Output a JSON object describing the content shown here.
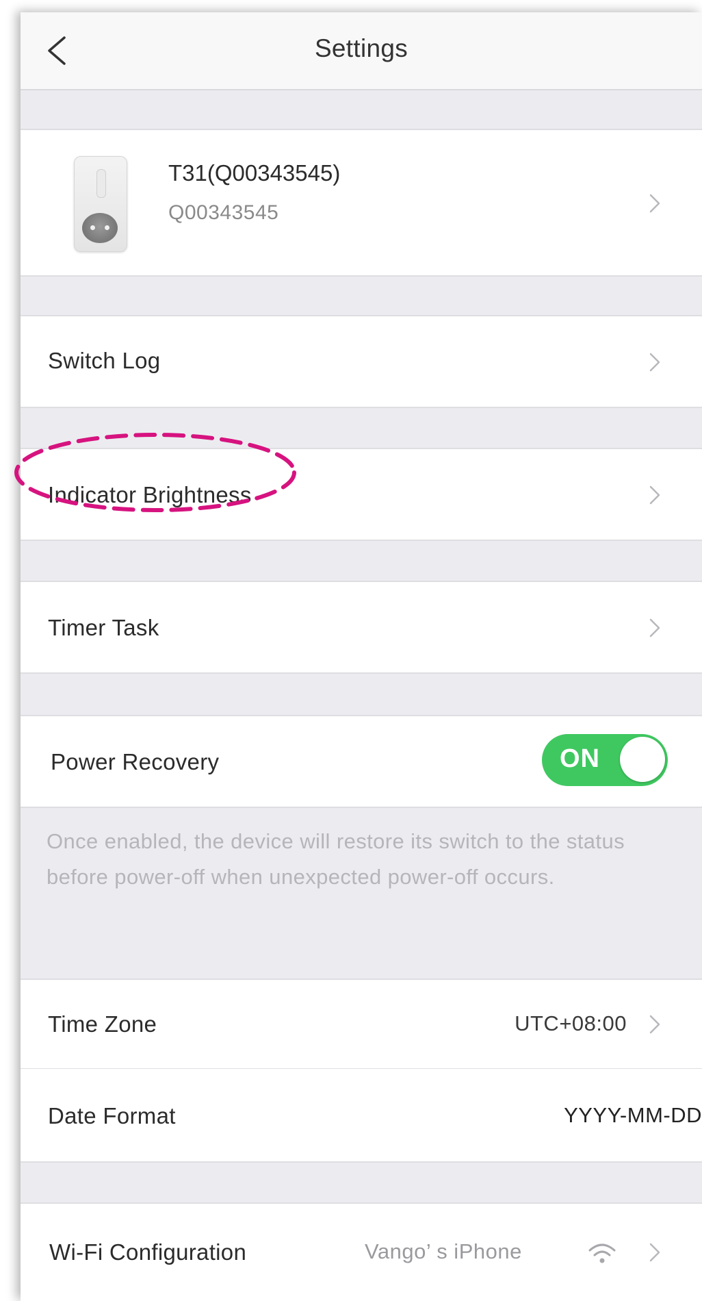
{
  "nav": {
    "title": "Settings"
  },
  "device": {
    "name": "T31(Q00343545)",
    "id": "Q00343545"
  },
  "rows": {
    "switch_log": "Switch Log",
    "indicator_brightness": "Indicator Brightness",
    "timer_task": "Timer Task",
    "power_recovery": "Power Recovery",
    "time_zone": "Time Zone",
    "date_format": "Date Format",
    "wifi_configuration": "Wi-Fi Configuration"
  },
  "values": {
    "time_zone": "UTC+08:00",
    "date_format": "YYYY-MM-DD",
    "wifi_network": "Vango’ s iPhone"
  },
  "power_recovery": {
    "toggle_label": "ON",
    "enabled": true,
    "description": "Once enabled, the device will restore its switch to the status before power-off when unexpected power-off occurs."
  },
  "colors": {
    "toggle_on": "#3fc860",
    "highlight": "#d6137f",
    "background": "#ececf0"
  },
  "icons": {
    "back": "chevron-left-icon",
    "row_arrow": "chevron-right-icon",
    "wifi": "wifi-icon"
  }
}
